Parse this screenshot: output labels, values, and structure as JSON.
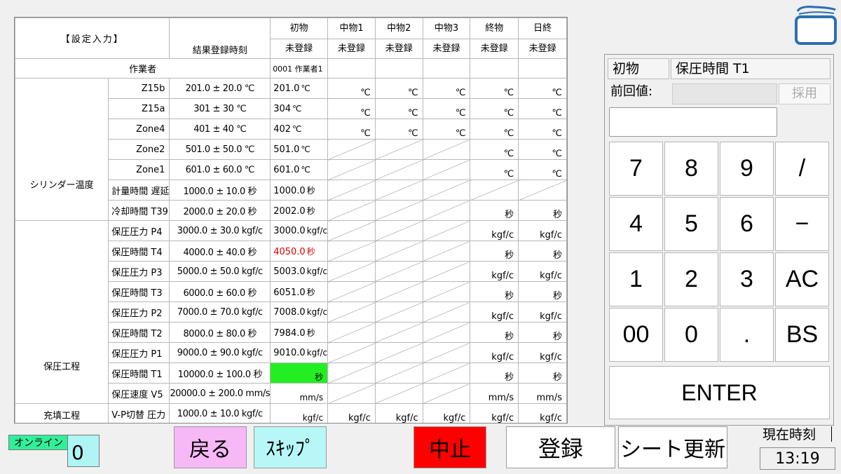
{
  "title": "【設定入力】",
  "record_time_label": "結果登録時刻",
  "stages": [
    {
      "name": "初物",
      "status": "未登録"
    },
    {
      "name": "中物1",
      "status": "未登録"
    },
    {
      "name": "中物2",
      "status": "未登録"
    },
    {
      "name": "中物3",
      "status": "未登録"
    },
    {
      "name": "終物",
      "status": "未登録"
    },
    {
      "name": "日終",
      "status": "未登録"
    }
  ],
  "operator": {
    "label": "作業者",
    "value": "0001 作業者1"
  },
  "sections": {
    "cylinder": "シリンダー温度",
    "holding": "保圧工程",
    "filling": "充填工程"
  },
  "rows": [
    {
      "item": "Z15b",
      "spec": "201.0 ± 20.0 ℃",
      "value": "201.0",
      "unit": "℃",
      "c1": "℃",
      "c2": "℃",
      "c3": "℃",
      "c4": "℃",
      "c5": "℃"
    },
    {
      "item": "Z15a",
      "spec": "301 ± 30 ℃",
      "value": "304",
      "unit": "℃",
      "c1": "℃",
      "c2": "℃",
      "c3": "℃",
      "c4": "℃",
      "c5": "℃"
    },
    {
      "item": "Zone4",
      "spec": "401 ± 40 ℃",
      "value": "402",
      "unit": "℃",
      "c1": "℃",
      "c2": "℃",
      "c3": "℃",
      "c4": "℃",
      "c5": "℃"
    },
    {
      "item": "Zone2",
      "spec": "501.0 ± 50.0 ℃",
      "value": "501.0",
      "unit": "℃",
      "c4": "℃",
      "c5": "℃"
    },
    {
      "item": "Zone1",
      "spec": "601.0 ± 60.0 ℃",
      "value": "601.0",
      "unit": "℃",
      "c4": "℃",
      "c5": "℃"
    },
    {
      "item": "計量時間 遅延",
      "spec": "1000.0 ± 10.0 秒",
      "value": "1000.0",
      "unit": "秒"
    },
    {
      "item": "冷却時間 T39",
      "spec": "2000.0 ± 20.0 秒",
      "value": "2002.0",
      "unit": "秒",
      "c4": "秒",
      "c5": "秒"
    },
    {
      "item": "保圧圧力 P4",
      "spec": "3000.0 ± 30.0 kgf/c",
      "value": "3000.0",
      "unit": "kgf/c",
      "c4": "kgf/c",
      "c5": "kgf/c"
    },
    {
      "item": "保圧時間 T4",
      "spec": "4000.0 ± 40.0 秒",
      "value": "4050.0",
      "unit": "秒",
      "c4": "秒",
      "c5": "秒"
    },
    {
      "item": "保圧圧力 P3",
      "spec": "5000.0 ± 50.0 kgf/c",
      "value": "5003.0",
      "unit": "kgf/c",
      "c4": "kgf/c",
      "c5": "kgf/c"
    },
    {
      "item": "保圧時間 T3",
      "spec": "6000.0 ± 60.0 秒",
      "value": "6051.0",
      "unit": "秒",
      "c4": "秒",
      "c5": "秒"
    },
    {
      "item": "保圧圧力 P2",
      "spec": "7000.0 ± 70.0 kgf/c",
      "value": "7008.0",
      "unit": "kgf/c",
      "c4": "kgf/c",
      "c5": "kgf/c"
    },
    {
      "item": "保圧時間 T2",
      "spec": "8000.0 ± 80.0 秒",
      "value": "7984.0",
      "unit": "秒",
      "c4": "秒",
      "c5": "秒"
    },
    {
      "item": "保圧圧力 P1",
      "spec": "9000.0 ± 90.0 kgf/c",
      "value": "9010.0",
      "unit": "kgf/c",
      "c4": "kgf/c",
      "c5": "kgf/c"
    },
    {
      "item": "保圧時間 T1",
      "spec": "10000.0 ± 100.0 秒",
      "value": "",
      "unit": "秒",
      "c4": "秒",
      "c5": "秒"
    },
    {
      "item": "保圧速度 V5",
      "spec": "20000.0 ± 200.0 mm/s",
      "value": "",
      "unit": "mm/s",
      "c4": "mm/s",
      "c5": "mm/s"
    },
    {
      "item": "V-P切替 圧力",
      "spec": "1000.0 ± 10.0 kgf/c",
      "value": "",
      "unit": "kgf/c",
      "c1": "kgf/c",
      "c2": "kgf/c",
      "c3": "kgf/c",
      "c4": "kgf/c",
      "c5": "kgf/c"
    }
  ],
  "panel": {
    "stage": "初物",
    "item": "保圧時間 T1",
    "prev_label": "前回値:",
    "prev_value": "",
    "adopt_label": "採用",
    "input_value": ""
  },
  "keypad": [
    "7",
    "8",
    "9",
    "/",
    "4",
    "5",
    "6",
    "−",
    "1",
    "2",
    "3",
    "AC",
    "00",
    "0",
    ".",
    "BS"
  ],
  "enter_label": "ENTER",
  "bottom": {
    "online_label": "オンライン",
    "online_count": "0",
    "back_label": "戻る",
    "skip_label": "ｽｷｯﾌﾟ",
    "stop_label": "中止",
    "register_label": "登録",
    "sheet_update_label": "シート更新",
    "clock_label": "現在時刻",
    "clock_value": "13:19"
  },
  "colors": {
    "stop_bg": "#ff0000",
    "back_bg": "#f7b8f7",
    "skip_bg": "#b8f7f7",
    "online_bg": "#33ee99",
    "count_bg": "#b0f5f5",
    "highlight": "#22ee22",
    "warn_text": "#e00000"
  }
}
